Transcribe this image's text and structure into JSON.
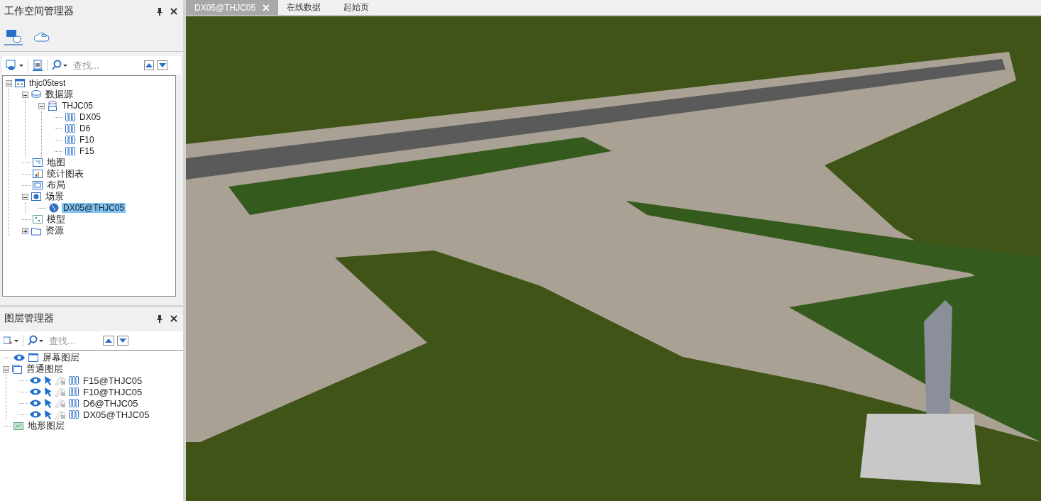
{
  "workspace_panel": {
    "title": "工作空间管理器",
    "tabs": [
      {
        "kind": "local",
        "selected": true
      },
      {
        "kind": "online",
        "selected": false
      }
    ],
    "search": {
      "placeholder": "查找..."
    },
    "tree": [
      {
        "label": "thjc05test",
        "kind": "workspace",
        "expanded": true,
        "selected": false,
        "children": [
          {
            "label": "数据源",
            "kind": "datasource",
            "expanded": true,
            "selected": false,
            "children": [
              {
                "label": "THJC05",
                "kind": "database",
                "expanded": true,
                "selected": false,
                "children": [
                  {
                    "label": "DX05",
                    "kind": "cad",
                    "selected": false
                  },
                  {
                    "label": "D6",
                    "kind": "cad",
                    "selected": false
                  },
                  {
                    "label": "F10",
                    "kind": "cad",
                    "selected": false
                  },
                  {
                    "label": "F15",
                    "kind": "cad",
                    "selected": false
                  }
                ]
              }
            ]
          },
          {
            "label": "地图",
            "kind": "map",
            "selected": false
          },
          {
            "label": "统计图表",
            "kind": "chart",
            "selected": false
          },
          {
            "label": "布局",
            "kind": "layout",
            "selected": false
          },
          {
            "label": "场景",
            "kind": "scene",
            "expanded": true,
            "selected": false,
            "children": [
              {
                "label": "DX05@THJC05",
                "kind": "globe",
                "selected": true
              }
            ]
          },
          {
            "label": "模型",
            "kind": "model",
            "selected": false
          },
          {
            "label": "资源",
            "kind": "folder",
            "expanded": false,
            "selected": false
          }
        ]
      }
    ]
  },
  "layer_panel": {
    "title": "图层管理器",
    "search": {
      "placeholder": "查找..."
    },
    "tree": [
      {
        "label": "屏幕图层",
        "kind": "screen",
        "visible": true
      },
      {
        "label": "普通图层",
        "kind": "group",
        "expanded": true,
        "children": [
          {
            "label": "F15@THJC05",
            "kind": "cad",
            "visible": true,
            "selectable": true,
            "editable": false
          },
          {
            "label": "F10@THJC05",
            "kind": "cad",
            "visible": true,
            "selectable": true,
            "editable": false
          },
          {
            "label": "D6@THJC05",
            "kind": "cad",
            "visible": true,
            "selectable": true,
            "editable": false
          },
          {
            "label": "DX05@THJC05",
            "kind": "cad",
            "visible": true,
            "selectable": true,
            "editable": false
          }
        ]
      },
      {
        "label": "地形图层",
        "kind": "terrain"
      }
    ]
  },
  "document_tabs": [
    {
      "label": "DX05@THJC05",
      "selected": true,
      "closable": true
    },
    {
      "label": "在线数据",
      "selected": false,
      "closable": false
    },
    {
      "label": "起始页",
      "selected": false,
      "closable": false
    }
  ]
}
